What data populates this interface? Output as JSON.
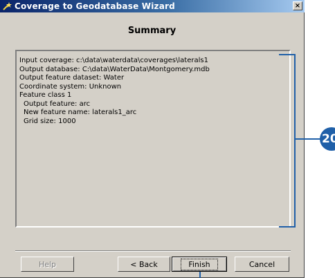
{
  "window": {
    "title": "Coverage to Geodatabase Wizard",
    "close_glyph": "×"
  },
  "page": {
    "heading": "Summary"
  },
  "summary": [
    {
      "text": "Input coverage:  c:\\data\\waterdata\\coverages\\laterals1",
      "indent": false
    },
    {
      "text": "Output database:  C:\\data\\WaterData\\Montgomery.mdb",
      "indent": false
    },
    {
      "text": "Output feature dataset:  Water",
      "indent": false
    },
    {
      "text": "Coordinate system: Unknown",
      "indent": false
    },
    {
      "text": "Feature class 1",
      "indent": false
    },
    {
      "text": "Output feature: arc",
      "indent": true
    },
    {
      "text": "New feature name: laterals1_arc",
      "indent": true
    },
    {
      "text": "Grid size:  1000",
      "indent": true
    }
  ],
  "buttons": {
    "help": "Help",
    "back": "< Back",
    "finish": "Finish",
    "cancel": "Cancel"
  },
  "callout": {
    "number": "20",
    "color": "#1f5fa8"
  },
  "icons": {
    "title": "wizard-wand-icon",
    "close": "close-icon"
  }
}
